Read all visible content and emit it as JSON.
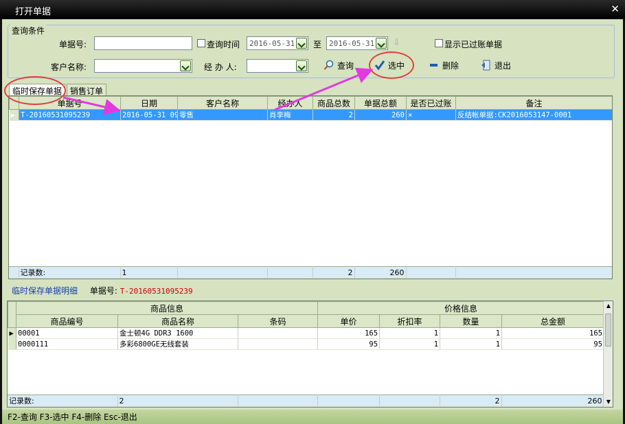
{
  "window": {
    "title": "打开单据"
  },
  "query": {
    "legend": "查询条件",
    "doc_no_label": "单据号:",
    "doc_no_value": "",
    "query_time_label": "查询时间",
    "date_from": "2016-05-31",
    "to_label": "至",
    "date_to": "2016-05-31",
    "show_posted_label": "显示已过账单据",
    "customer_label": "客户名称:",
    "customer_value": "",
    "handler_label": "经 办 人:",
    "handler_value": "",
    "search_label": "查询",
    "select_label": "选中",
    "delete_label": "删除",
    "exit_label": "退出"
  },
  "tabs": [
    {
      "label": "临时保存单据",
      "active": true
    },
    {
      "label": "销售订单",
      "active": false
    }
  ],
  "main_grid": {
    "columns": [
      "单据号",
      "日期",
      "客户名称",
      "经办人",
      "商品总数",
      "单据总额",
      "是否已过账",
      "备注"
    ],
    "rows": [
      {
        "doc_no": "T-20160531095239",
        "date": "2016-05-31 09",
        "customer": "零售",
        "handler": "肖李梅",
        "qty": "2",
        "amount": "260",
        "posted": "×",
        "remark": "反结帐单据:CK2016053147-0001"
      }
    ],
    "footer": {
      "label": "记录数:",
      "count": "1",
      "qty": "2",
      "amount": "260"
    }
  },
  "detail": {
    "title": "临时保存单据明细",
    "doc_label": "单据号:",
    "doc_value": "T-20160531095239",
    "group1": "商品信息",
    "group2": "价格信息",
    "columns": [
      "商品编号",
      "商品名称",
      "条码",
      "单价",
      "折扣率",
      "数量",
      "总金额"
    ],
    "rows": [
      {
        "code": "00001",
        "name": "金士顿4G DDR3 1600",
        "barcode": "",
        "price": "165",
        "discount": "1",
        "qty": "1",
        "total": "165"
      },
      {
        "code": "0000111",
        "name": "多彩6800GE无线套装",
        "barcode": "",
        "price": "95",
        "discount": "1",
        "qty": "1",
        "total": "95"
      }
    ],
    "footer": {
      "label": "记录数:",
      "count": "2",
      "qty": "2",
      "total": "260"
    }
  },
  "status": {
    "text": "F2-查询 F3-选中 F4-删除 Esc-退出"
  },
  "colors": {
    "selection": "#3399ff",
    "annotation": "#e0403a",
    "arrow": "#e23adf",
    "doc_red": "#cc0000"
  }
}
